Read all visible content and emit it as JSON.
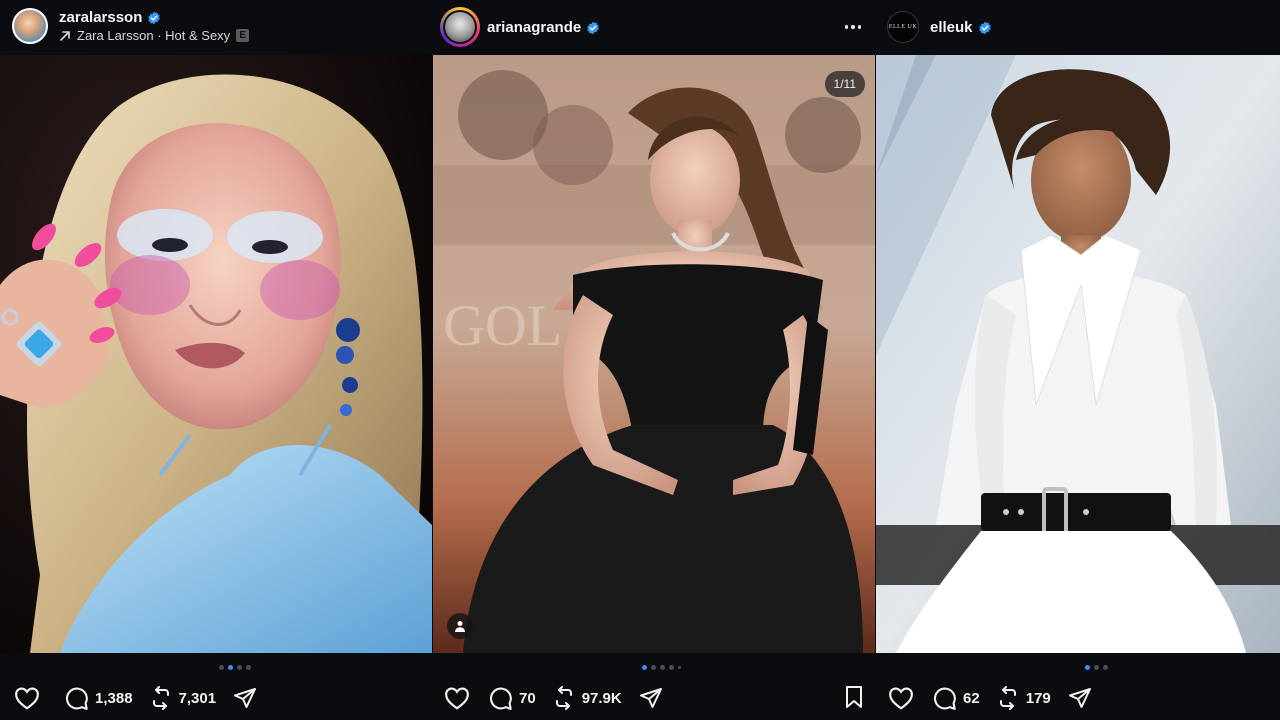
{
  "posts": [
    {
      "username": "zaralarsson",
      "verified": true,
      "audio": {
        "label": "Zara Larsson · Hot & Sexy",
        "explicit_badge": "E"
      },
      "carousel": {
        "total_dots": 4,
        "active_index": 1
      },
      "actions": {
        "comments": "1,388",
        "reposts": "7,301"
      },
      "icons": [
        "heart-icon",
        "comment-icon",
        "repost-icon",
        "share-icon"
      ]
    },
    {
      "username": "arianagrande",
      "verified": true,
      "carousel": {
        "counter": "1/11",
        "total_dots": 5,
        "active_index": 0
      },
      "actions": {
        "comments": "70",
        "reposts": "97.9K"
      },
      "icons": [
        "heart-icon",
        "comment-icon",
        "repost-icon",
        "share-icon",
        "bookmark-icon",
        "more-icon",
        "tagged-user-icon"
      ]
    },
    {
      "username": "elleuk",
      "verified": true,
      "avatar_text": "ELLE UK",
      "carousel": {
        "total_dots": 3,
        "active_index": 0
      },
      "actions": {
        "comments": "62",
        "reposts": "179"
      },
      "icons": [
        "heart-icon",
        "comment-icon",
        "repost-icon",
        "share-icon"
      ]
    }
  ],
  "colors": {
    "background": "#0b0c10",
    "verified": "#3897f0",
    "active_dot": "#3f8cff"
  }
}
